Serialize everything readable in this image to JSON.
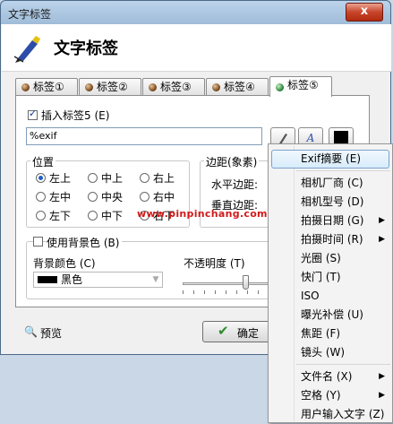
{
  "window": {
    "title": "文字标签",
    "close_label": "x"
  },
  "header": {
    "title": "文字标签"
  },
  "tabs": [
    "标签①",
    "标签②",
    "标签③",
    "标签④",
    "标签⑤"
  ],
  "active_tab": 4,
  "insert": {
    "label": "插入标签5 (E)",
    "checked": true,
    "text_value": "%exif"
  },
  "toolbar": {
    "font_label": "A"
  },
  "position": {
    "title": "位置",
    "options": [
      "左上",
      "中上",
      "右上",
      "左中",
      "中央",
      "右中",
      "左下",
      "中下",
      "右下"
    ],
    "selected": "左上"
  },
  "margin": {
    "title": "边距(象素)",
    "horizontal_label": "水平边距:",
    "vertical_label": "垂直边距:"
  },
  "watermark_text": "www.pinpinchang.com",
  "background": {
    "use_label": "使用背景色 (B)",
    "checked": false,
    "color_label": "背景颜色 (C)",
    "color_value": "黑色",
    "opacity_label": "不透明度 (T)",
    "opacity": 0.7
  },
  "footer": {
    "preview_label": "预览",
    "ok_label": "确定"
  },
  "context_menu": {
    "items": [
      {
        "label": "Exif摘要 (E)",
        "submenu": false,
        "highlighted": true
      },
      {
        "separator": true
      },
      {
        "label": "相机厂商 (C)",
        "submenu": false
      },
      {
        "label": "相机型号 (D)",
        "submenu": false
      },
      {
        "label": "拍摄日期 (G)",
        "submenu": true
      },
      {
        "label": "拍摄时间 (R)",
        "submenu": true
      },
      {
        "label": "光圈 (S)",
        "submenu": false
      },
      {
        "label": "快门 (T)",
        "submenu": false
      },
      {
        "label": "ISO",
        "submenu": false
      },
      {
        "label": "曝光补偿 (U)",
        "submenu": false
      },
      {
        "label": "焦距 (F)",
        "submenu": false
      },
      {
        "label": "镜头 (W)",
        "submenu": false
      },
      {
        "separator": true
      },
      {
        "label": "文件名 (X)",
        "submenu": true
      },
      {
        "label": "空格 (Y)",
        "submenu": true
      },
      {
        "label": "用户输入文字 (Z)",
        "submenu": false
      }
    ]
  },
  "colors": {
    "accent": "#1d5fc4",
    "watermark": "#d21a1a",
    "menu_highlight": "#d8ecfb"
  }
}
